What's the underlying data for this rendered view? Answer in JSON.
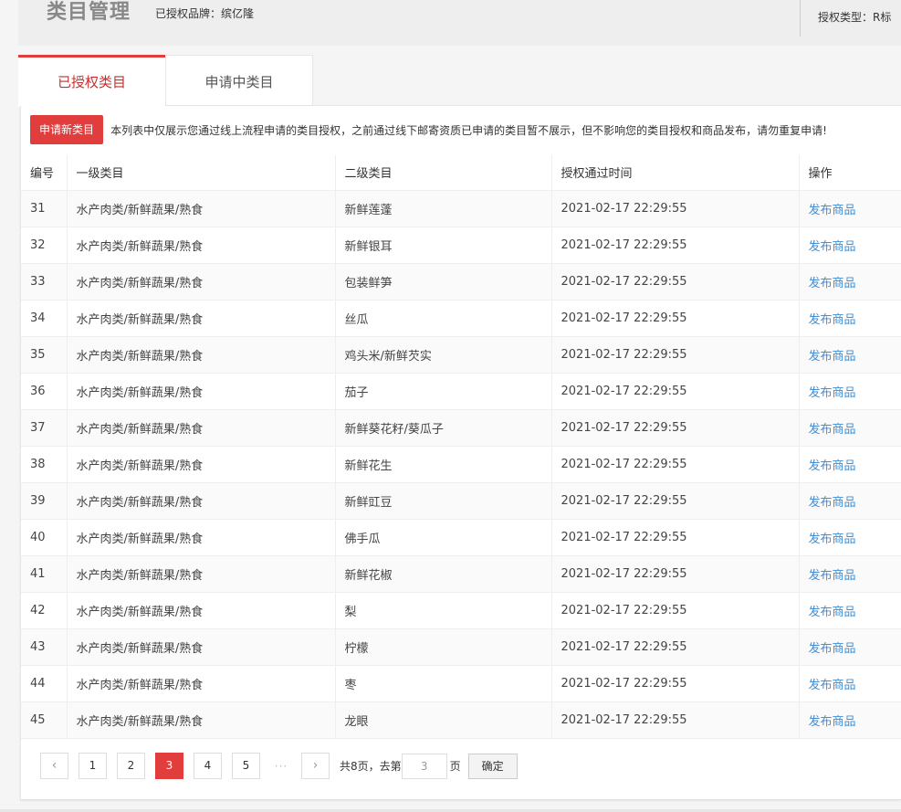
{
  "header": {
    "title": "类目管理",
    "brand": "已授权品牌：缤亿隆",
    "auth_type": "授权类型：R标"
  },
  "tabs": [
    {
      "label": "已授权类目"
    },
    {
      "label": "申请中类目"
    }
  ],
  "toolbar": {
    "apply_label": "申请新类目",
    "notice": "本列表中仅展示您通过线上流程申请的类目授权，之前通过线下邮寄资质已申请的类目暂不展示，但不影响您的类目授权和商品发布，请勿重复申请!"
  },
  "table": {
    "headers": [
      "编号",
      "一级类目",
      "二级类目",
      "授权通过时间",
      "操作"
    ],
    "rows": [
      {
        "id": "31",
        "cat1": "水产肉类/新鲜蔬果/熟食",
        "cat2": "新鲜莲蓬",
        "time": "2021-02-17 22:29:55",
        "op": "发布商品"
      },
      {
        "id": "32",
        "cat1": "水产肉类/新鲜蔬果/熟食",
        "cat2": "新鲜银耳",
        "time": "2021-02-17 22:29:55",
        "op": "发布商品"
      },
      {
        "id": "33",
        "cat1": "水产肉类/新鲜蔬果/熟食",
        "cat2": "包装鲜笋",
        "time": "2021-02-17 22:29:55",
        "op": "发布商品"
      },
      {
        "id": "34",
        "cat1": "水产肉类/新鲜蔬果/熟食",
        "cat2": "丝瓜",
        "time": "2021-02-17 22:29:55",
        "op": "发布商品"
      },
      {
        "id": "35",
        "cat1": "水产肉类/新鲜蔬果/熟食",
        "cat2": "鸡头米/新鲜芡实",
        "time": "2021-02-17 22:29:55",
        "op": "发布商品"
      },
      {
        "id": "36",
        "cat1": "水产肉类/新鲜蔬果/熟食",
        "cat2": "茄子",
        "time": "2021-02-17 22:29:55",
        "op": "发布商品"
      },
      {
        "id": "37",
        "cat1": "水产肉类/新鲜蔬果/熟食",
        "cat2": "新鲜葵花籽/葵瓜子",
        "time": "2021-02-17 22:29:55",
        "op": "发布商品"
      },
      {
        "id": "38",
        "cat1": "水产肉类/新鲜蔬果/熟食",
        "cat2": "新鲜花生",
        "time": "2021-02-17 22:29:55",
        "op": "发布商品"
      },
      {
        "id": "39",
        "cat1": "水产肉类/新鲜蔬果/熟食",
        "cat2": "新鲜豇豆",
        "time": "2021-02-17 22:29:55",
        "op": "发布商品"
      },
      {
        "id": "40",
        "cat1": "水产肉类/新鲜蔬果/熟食",
        "cat2": "佛手瓜",
        "time": "2021-02-17 22:29:55",
        "op": "发布商品"
      },
      {
        "id": "41",
        "cat1": "水产肉类/新鲜蔬果/熟食",
        "cat2": "新鲜花椒",
        "time": "2021-02-17 22:29:55",
        "op": "发布商品"
      },
      {
        "id": "42",
        "cat1": "水产肉类/新鲜蔬果/熟食",
        "cat2": "梨",
        "time": "2021-02-17 22:29:55",
        "op": "发布商品"
      },
      {
        "id": "43",
        "cat1": "水产肉类/新鲜蔬果/熟食",
        "cat2": "柠檬",
        "time": "2021-02-17 22:29:55",
        "op": "发布商品"
      },
      {
        "id": "44",
        "cat1": "水产肉类/新鲜蔬果/熟食",
        "cat2": "枣",
        "time": "2021-02-17 22:29:55",
        "op": "发布商品"
      },
      {
        "id": "45",
        "cat1": "水产肉类/新鲜蔬果/熟食",
        "cat2": "龙眼",
        "time": "2021-02-17 22:29:55",
        "op": "发布商品"
      }
    ]
  },
  "pagination": {
    "prev_icon": "‹",
    "pages": [
      "1",
      "2",
      "3",
      "4",
      "5"
    ],
    "current": "3",
    "ellipsis": "···",
    "next_icon": "›",
    "total_prefix": "共8页，去第",
    "goto_value": "3",
    "page_suffix": "页",
    "confirm_label": "确定"
  },
  "colors": {
    "accent": "#e13d3d",
    "link": "#3d8fd8"
  }
}
